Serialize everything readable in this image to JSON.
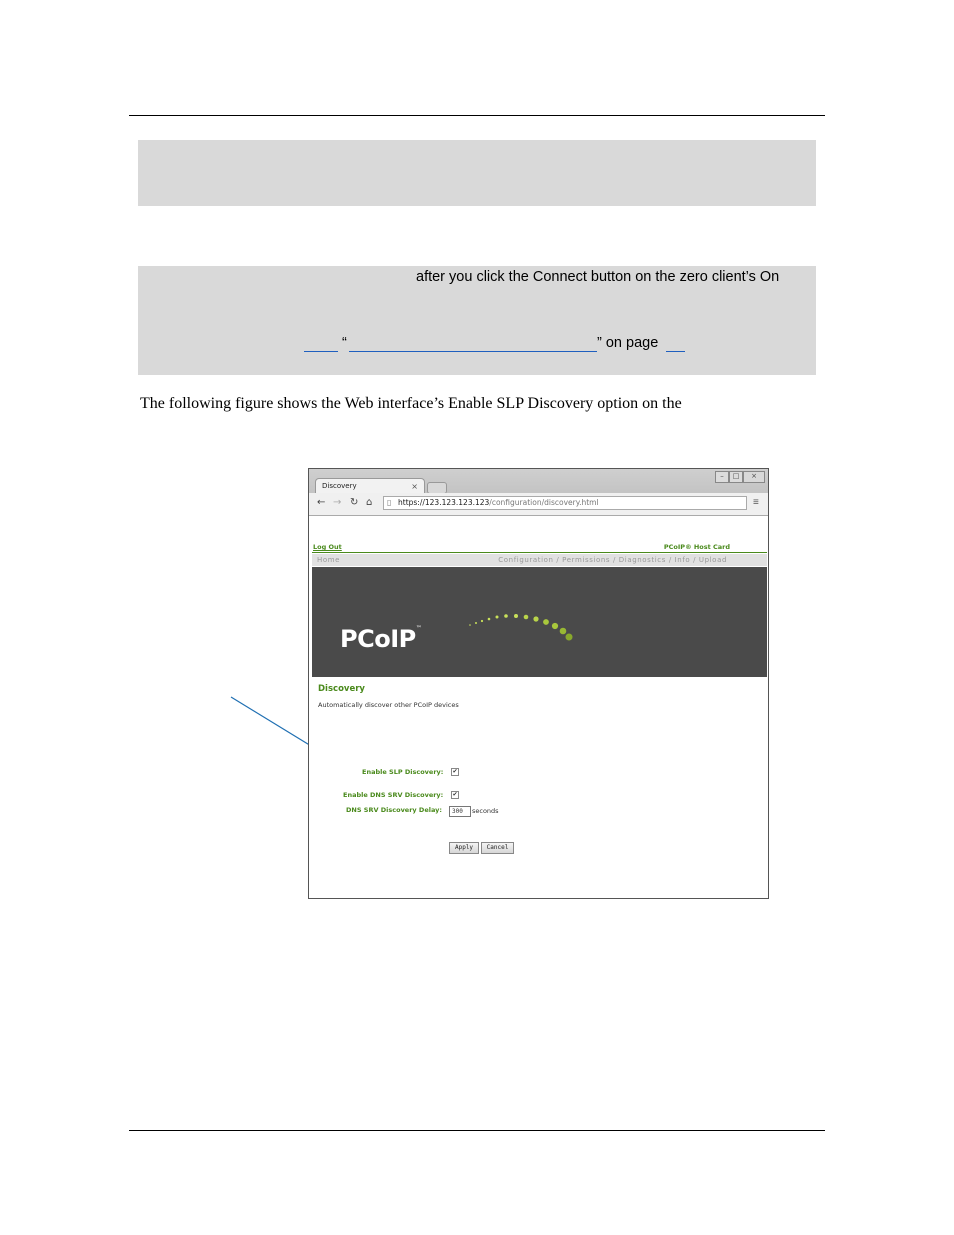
{
  "note1": {
    "text": ""
  },
  "note2": {
    "line1": "after you click the Connect button on the zero client’s On",
    "line3_quote_open": "“",
    "line3_quote_close": "” on page"
  },
  "body": {
    "paragraph": "The following figure shows the Web interface’s Enable SLP Discovery option on the"
  },
  "figure": {
    "browser": {
      "tab_title": "Discovery",
      "tab_close": "×",
      "url_host": "https://123.123.123.123",
      "url_path": "/configuration/discovery.html",
      "back_icon": "arrow-left-icon",
      "forward_icon": "arrow-right-icon",
      "reload_icon": "reload-icon",
      "home_icon": "home-icon",
      "menu_icon": "menu-icon"
    },
    "header": {
      "logout": "Log Out",
      "host_card": "PCoIP® Host Card"
    },
    "nav": {
      "home": "Home",
      "menu": "Configuration / Permissions / Diagnostics / Info / Upload"
    },
    "banner": {
      "logo": "PCoIP",
      "tm": "™"
    },
    "content": {
      "heading": "Discovery",
      "subtext": "Automatically discover other PCoIP devices",
      "slp_label": "Enable SLP Discovery:",
      "slp_checked": "✔",
      "dns_label": "Enable DNS SRV Discovery:",
      "dns_checked": "✔",
      "delay_label": "DNS SRV Discovery Delay:",
      "delay_value": "300",
      "delay_unit": "seconds",
      "apply": "Apply",
      "cancel": "Cancel"
    },
    "colors": {
      "accent_green": "#4a8a1c",
      "arrow_blue": "#1f6fb2",
      "banner_gray": "#4a4a4a"
    }
  }
}
